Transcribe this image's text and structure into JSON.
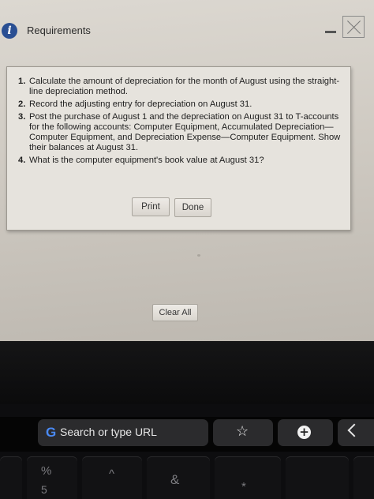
{
  "dialog": {
    "title": "Requirements",
    "info_icon_glyph": "i",
    "requirements": [
      {
        "num": "1.",
        "text": "Calculate the amount of depreciation for the month of August using the straight-line depreciation method."
      },
      {
        "num": "2.",
        "text": "Record the adjusting entry for depreciation on August 31."
      },
      {
        "num": "3.",
        "text": "Post the purchase of August 1 and the depreciation on August 31 to T-accounts for the following accounts: Computer Equipment, Accumulated Depreciation—Computer Equipment, and Depreciation Expense—Computer Equipment. Show their balances at August 31."
      },
      {
        "num": "4.",
        "text": "What is the computer equipment's book value at August 31?"
      }
    ],
    "print_label": "Print",
    "done_label": "Done"
  },
  "page": {
    "clear_all_label": "Clear All"
  },
  "touch_bar": {
    "google_glyph": "G",
    "search_text": "Search or type URL",
    "star_glyph": "☆",
    "plus_glyph": "+"
  },
  "keyboard": {
    "percent_key_top": "%",
    "percent_key_bottom": "5",
    "caret_key": "^",
    "ampersand_key": "&",
    "asterisk_key": "*"
  },
  "colors": {
    "info_icon": "#2a4f93",
    "google_blue": "#4a8af4"
  }
}
